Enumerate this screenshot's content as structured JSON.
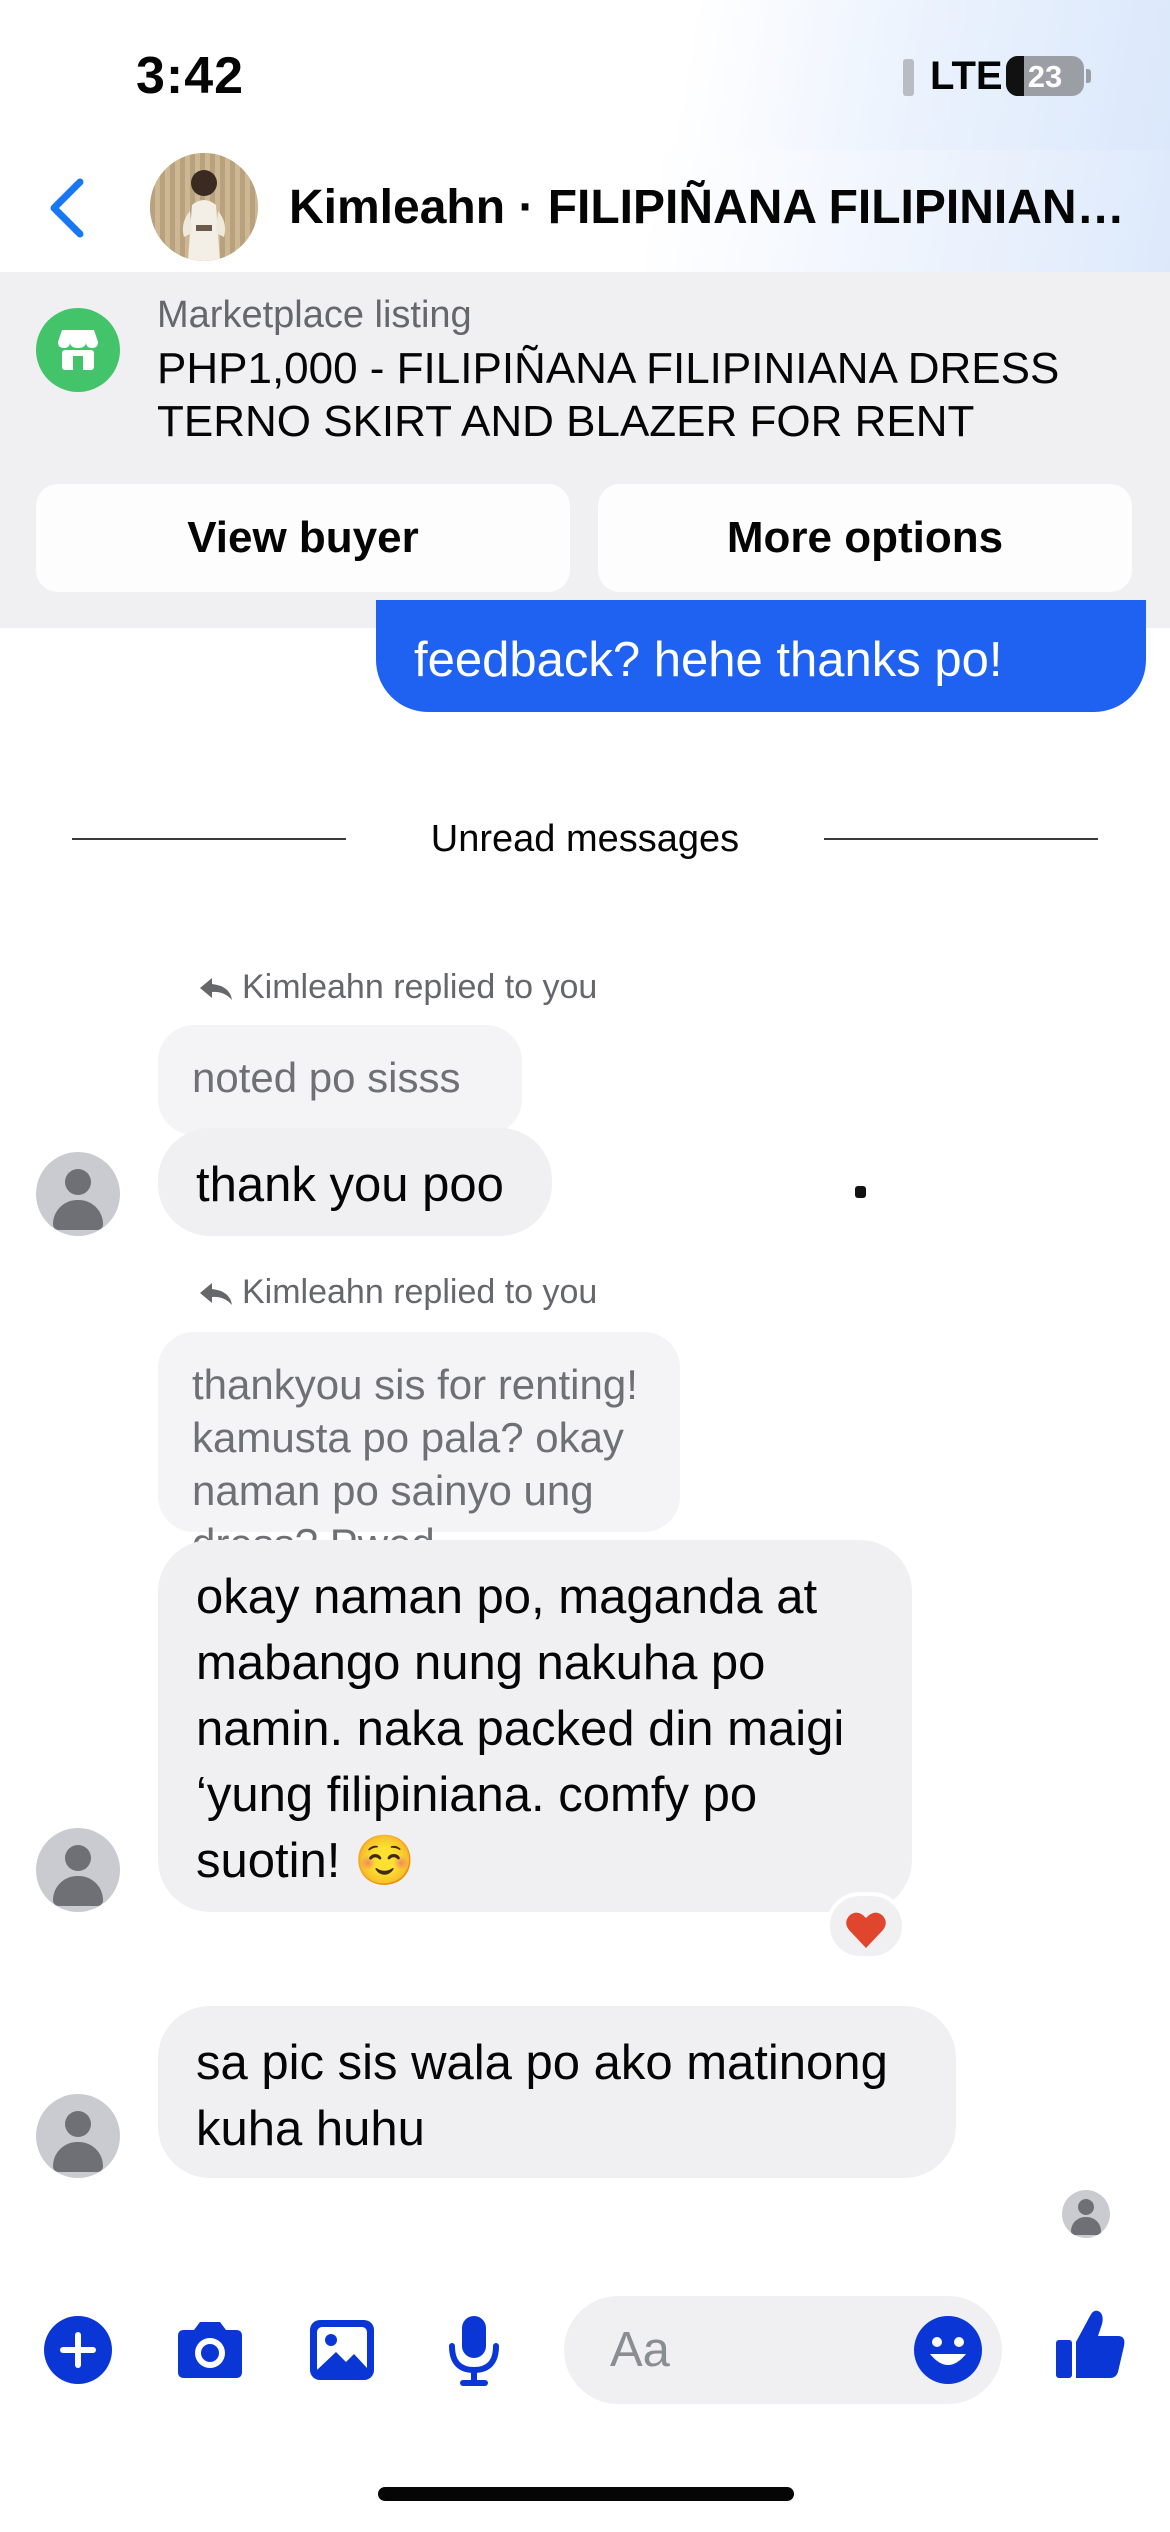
{
  "status_bar": {
    "time": "3:42",
    "network": "LTE",
    "battery": "23",
    "battery_level": 0.23
  },
  "header": {
    "title": "Kimleahn · FILIPIÑANA FILIPINIANA DRESS TERNO SKIRT AND BLAZER FOR RENT",
    "back_icon": "chevron-left-icon"
  },
  "listing": {
    "label": "Marketplace listing",
    "title": "PHP1,000 - FILIPIÑANA FILIPINIANA DRESS TERNO SKIRT AND BLAZER FOR RENT",
    "icon": "shop-icon",
    "buttons": {
      "view_buyer": "View buyer",
      "more_options": "More options"
    }
  },
  "messages": {
    "sent_partial": "feedback? hehe thanks po!",
    "divider": "Unread messages",
    "reply_indicator": "Kimleahn replied to you",
    "thread": [
      {
        "quoted": "noted po sisss",
        "text": "thank you poo"
      },
      {
        "quoted": "thankyou sis for renting! kamusta po pala? okay naman po sainyo ung dress?  Pwed...",
        "text": "okay naman po, maganda at mabango nung nakuha po namin. naka packed din maigi ‘yung filipiniana. comfy po suotin! ☺️",
        "reaction": "heart"
      },
      {
        "text": "sa pic sis wala po ako matinong kuha huhu"
      }
    ]
  },
  "composer": {
    "placeholder": "Aa",
    "icons": [
      "plus-icon",
      "camera-icon",
      "gallery-icon",
      "microphone-icon",
      "emoji-icon",
      "like-icon"
    ]
  },
  "colors": {
    "accent": "#0a36d6",
    "back_arrow": "#1877f2",
    "sent_bubble": "#1f62f2",
    "received_bubble": "#f0f0f3",
    "shop_icon": "#43c46b",
    "reaction_heart": "#e0452e"
  }
}
